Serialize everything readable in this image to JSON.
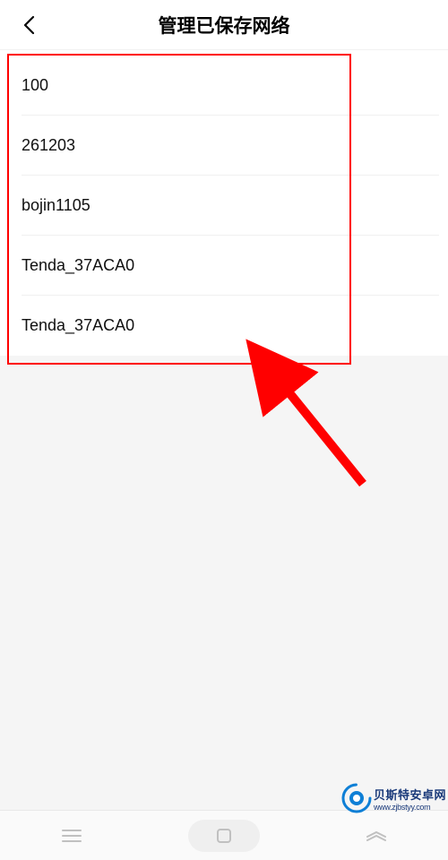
{
  "header": {
    "title": "管理已保存网络"
  },
  "networks": [
    {
      "name": "100"
    },
    {
      "name": "261203"
    },
    {
      "name": "bojin1105"
    },
    {
      "name": "Tenda_37ACA0"
    },
    {
      "name": "Tenda_37ACA0"
    }
  ],
  "annotation": {
    "highlight": "red-box",
    "arrow": "red-arrow"
  },
  "watermark": {
    "line1": "贝斯特安卓网",
    "line2": "www.zjbstyy.com"
  },
  "colors": {
    "annotation": "#ff0000",
    "watermark_brand": "#1a3a7a",
    "watermark_accent": "#0E7FD6"
  }
}
